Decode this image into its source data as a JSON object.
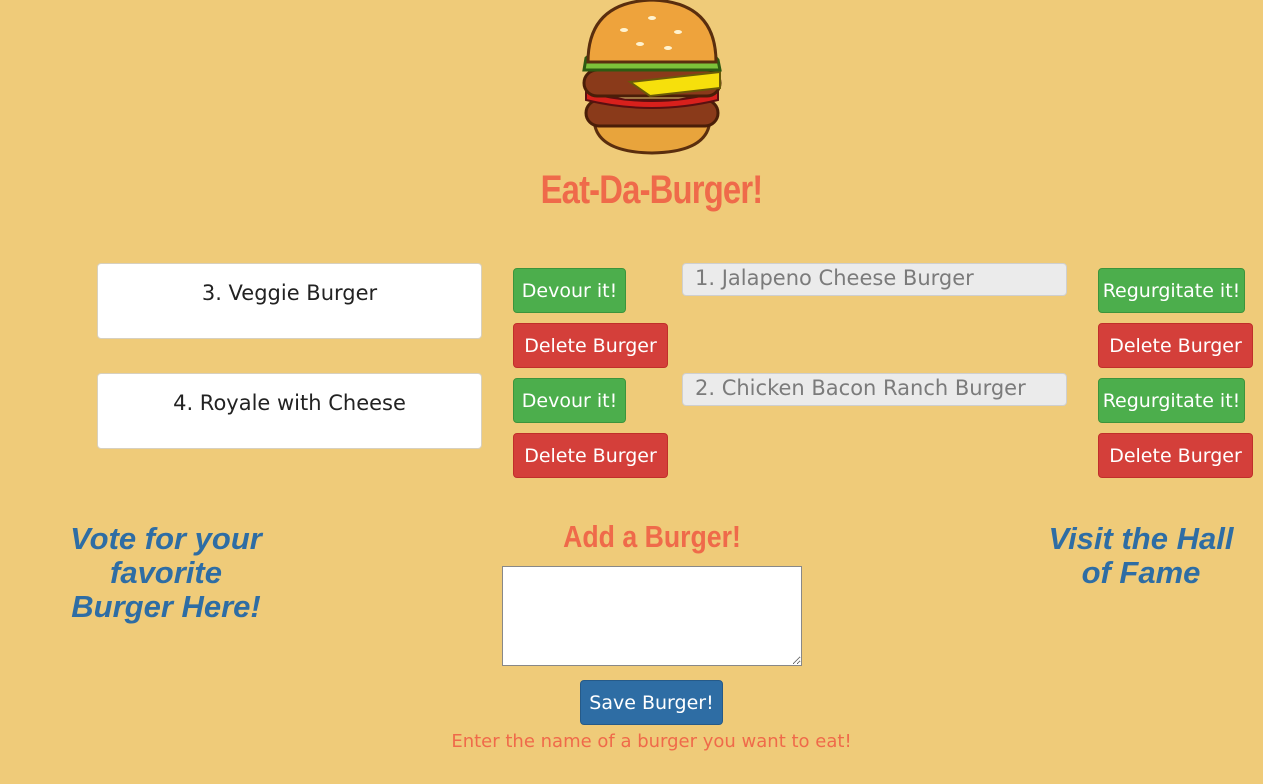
{
  "header": {
    "title": "Eat-Da-Burger!",
    "logo_icon": "burger-icon"
  },
  "to_eat": [
    {
      "name": "3. Veggie Burger",
      "devour_label": "Devour it!",
      "delete_label": "Delete Burger"
    },
    {
      "name": "4. Royale with Cheese",
      "devour_label": "Devour it!",
      "delete_label": "Delete Burger"
    }
  ],
  "eaten": [
    {
      "name": "1. Jalapeno Cheese Burger",
      "regurgitate_label": "Regurgitate it!",
      "delete_label": "Delete Burger"
    },
    {
      "name": "2. Chicken Bacon Ranch Burger",
      "regurgitate_label": "Regurgitate it!",
      "delete_label": "Delete Burger"
    }
  ],
  "vote": {
    "line1": "Vote for your",
    "line2": "favorite",
    "line3": "Burger Here!"
  },
  "hall_of_fame": {
    "line1": "Visit the Hall",
    "line2": "of Fame"
  },
  "add_form": {
    "heading": "Add a Burger!",
    "input_value": "",
    "save_label": "Save Burger!",
    "hint": "Enter the name of a burger you want to eat!"
  },
  "colors": {
    "background": "#efcb79",
    "accent": "#ef6a4a",
    "link_blue": "#2e6da4",
    "button_green": "#4cae4c",
    "button_red": "#d43f3a"
  }
}
